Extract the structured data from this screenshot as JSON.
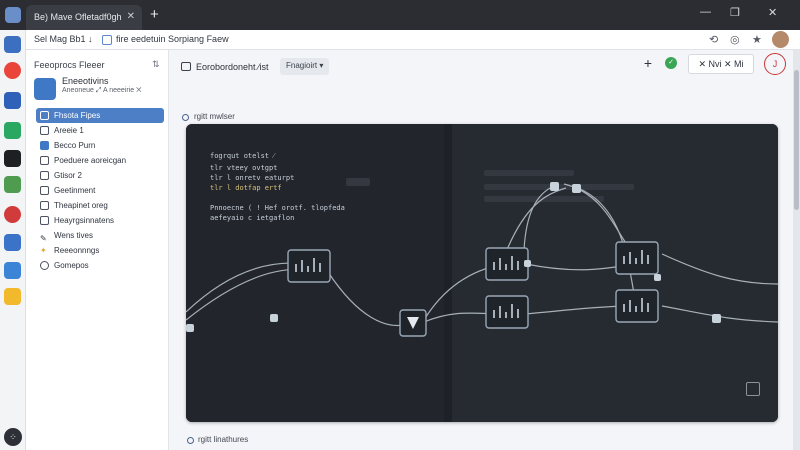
{
  "browser": {
    "tab_title": "Be) Mave Ofletadf0gh",
    "tab_close": "✕",
    "new_tab": "+",
    "window_controls": [
      "—",
      "❐",
      "✕"
    ]
  },
  "address": {
    "crumb_left": "Sel Mag Bb1",
    "crumb_arrow": "↓",
    "crumb_title": "fire eedetuin Sorpiang Faew",
    "icons": [
      "refresh-icon",
      "shield-icon",
      "star-icon"
    ]
  },
  "sidebar": {
    "header": "Feeoprocs Fleeer",
    "header_icon": "⇅",
    "project_title": "Eneeotivins",
    "project_sub": "Aneoneue  ⤢  A neeeirie  ✕",
    "items": [
      {
        "label": "Fhsota Fipes",
        "active": true
      },
      {
        "label": "Areeie 1",
        "active": false
      },
      {
        "label": "Becco Purn",
        "active": false
      },
      {
        "label": "Poeduere aoreicgan",
        "active": false
      },
      {
        "label": "Gtisor 2",
        "active": false
      },
      {
        "label": "Geetinment",
        "active": false
      },
      {
        "label": "Theapinet oreg",
        "active": false
      },
      {
        "label": "Heayrgsinnatens",
        "active": false
      },
      {
        "label": "Wens tives",
        "active": false
      },
      {
        "label": "Reeeonnngs",
        "active": false
      },
      {
        "label": "Gomepos",
        "active": false
      }
    ]
  },
  "toolbar": {
    "title": "Eorobordoneht ⁄ist",
    "select_label": "Fnagioirt",
    "plus_label": "+",
    "ok_label": "✓",
    "actions_label": "✕  Nvi  ✕  Mi",
    "circle_label": "J"
  },
  "sections": {
    "top_label": "rgitt mwlser",
    "bottom_label": "rgitt linathures"
  },
  "canvas": {
    "code_lines": [
      {
        "text": "fogrqut otelst  ⁄",
        "tone": "light"
      },
      {
        "text": "tlr  vteey ovtgpt",
        "tone": "light"
      },
      {
        "text": "tlr  l onretv eaturpt",
        "tone": "light"
      },
      {
        "text": "tlr  l dotfap ertf",
        "tone": "yellow"
      },
      {
        "text": "Pnnoecne ( ! Hef orotf.  tlopfeda",
        "tone": "light"
      },
      {
        "text": "aefeyaio  c  ietgaflon",
        "tone": "light"
      }
    ]
  },
  "colors": {
    "accent": "#4d7fc7",
    "canvas_bg": "#1e2128",
    "node_stroke": "#9aa8b6",
    "link": "#c8d2da",
    "ok": "#3aa655",
    "alert": "#c7383a"
  }
}
